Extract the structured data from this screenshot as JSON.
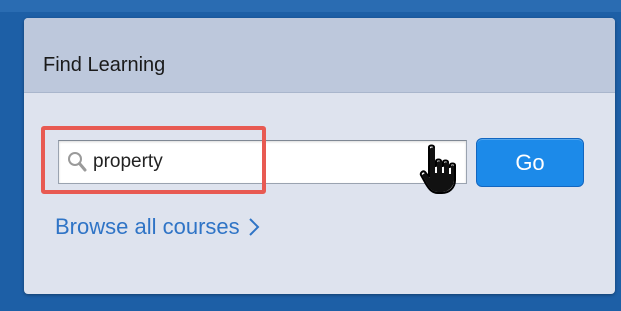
{
  "panel": {
    "title": "Find Learning"
  },
  "search": {
    "value": "property",
    "icon": "search-icon"
  },
  "go_button": {
    "label": "Go"
  },
  "browse_link": {
    "label": "Browse all courses",
    "icon": "chevron-right-icon"
  },
  "cursor": {
    "icon": "hand-pointer-icon"
  },
  "colors": {
    "background": "#1d5fa6",
    "panel": "#dee3ee",
    "header": "#bdc8dc",
    "accent": "#1c8ae9",
    "link": "#2f74c6",
    "highlight": "#e85a52"
  }
}
